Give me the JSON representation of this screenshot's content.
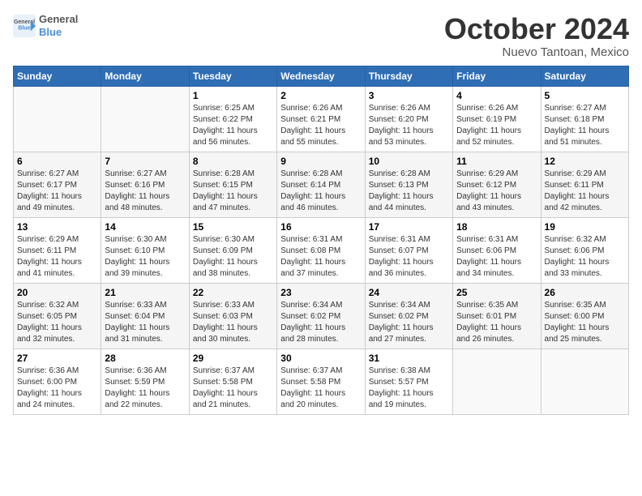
{
  "logo": {
    "line1": "General",
    "line2": "Blue"
  },
  "title": "October 2024",
  "location": "Nuevo Tantoan, Mexico",
  "days_header": [
    "Sunday",
    "Monday",
    "Tuesday",
    "Wednesday",
    "Thursday",
    "Friday",
    "Saturday"
  ],
  "weeks": [
    [
      {
        "day": "",
        "info": ""
      },
      {
        "day": "",
        "info": ""
      },
      {
        "day": "1",
        "info": "Sunrise: 6:25 AM\nSunset: 6:22 PM\nDaylight: 11 hours\nand 56 minutes."
      },
      {
        "day": "2",
        "info": "Sunrise: 6:26 AM\nSunset: 6:21 PM\nDaylight: 11 hours\nand 55 minutes."
      },
      {
        "day": "3",
        "info": "Sunrise: 6:26 AM\nSunset: 6:20 PM\nDaylight: 11 hours\nand 53 minutes."
      },
      {
        "day": "4",
        "info": "Sunrise: 6:26 AM\nSunset: 6:19 PM\nDaylight: 11 hours\nand 52 minutes."
      },
      {
        "day": "5",
        "info": "Sunrise: 6:27 AM\nSunset: 6:18 PM\nDaylight: 11 hours\nand 51 minutes."
      }
    ],
    [
      {
        "day": "6",
        "info": "Sunrise: 6:27 AM\nSunset: 6:17 PM\nDaylight: 11 hours\nand 49 minutes."
      },
      {
        "day": "7",
        "info": "Sunrise: 6:27 AM\nSunset: 6:16 PM\nDaylight: 11 hours\nand 48 minutes."
      },
      {
        "day": "8",
        "info": "Sunrise: 6:28 AM\nSunset: 6:15 PM\nDaylight: 11 hours\nand 47 minutes."
      },
      {
        "day": "9",
        "info": "Sunrise: 6:28 AM\nSunset: 6:14 PM\nDaylight: 11 hours\nand 46 minutes."
      },
      {
        "day": "10",
        "info": "Sunrise: 6:28 AM\nSunset: 6:13 PM\nDaylight: 11 hours\nand 44 minutes."
      },
      {
        "day": "11",
        "info": "Sunrise: 6:29 AM\nSunset: 6:12 PM\nDaylight: 11 hours\nand 43 minutes."
      },
      {
        "day": "12",
        "info": "Sunrise: 6:29 AM\nSunset: 6:11 PM\nDaylight: 11 hours\nand 42 minutes."
      }
    ],
    [
      {
        "day": "13",
        "info": "Sunrise: 6:29 AM\nSunset: 6:11 PM\nDaylight: 11 hours\nand 41 minutes."
      },
      {
        "day": "14",
        "info": "Sunrise: 6:30 AM\nSunset: 6:10 PM\nDaylight: 11 hours\nand 39 minutes."
      },
      {
        "day": "15",
        "info": "Sunrise: 6:30 AM\nSunset: 6:09 PM\nDaylight: 11 hours\nand 38 minutes."
      },
      {
        "day": "16",
        "info": "Sunrise: 6:31 AM\nSunset: 6:08 PM\nDaylight: 11 hours\nand 37 minutes."
      },
      {
        "day": "17",
        "info": "Sunrise: 6:31 AM\nSunset: 6:07 PM\nDaylight: 11 hours\nand 36 minutes."
      },
      {
        "day": "18",
        "info": "Sunrise: 6:31 AM\nSunset: 6:06 PM\nDaylight: 11 hours\nand 34 minutes."
      },
      {
        "day": "19",
        "info": "Sunrise: 6:32 AM\nSunset: 6:06 PM\nDaylight: 11 hours\nand 33 minutes."
      }
    ],
    [
      {
        "day": "20",
        "info": "Sunrise: 6:32 AM\nSunset: 6:05 PM\nDaylight: 11 hours\nand 32 minutes."
      },
      {
        "day": "21",
        "info": "Sunrise: 6:33 AM\nSunset: 6:04 PM\nDaylight: 11 hours\nand 31 minutes."
      },
      {
        "day": "22",
        "info": "Sunrise: 6:33 AM\nSunset: 6:03 PM\nDaylight: 11 hours\nand 30 minutes."
      },
      {
        "day": "23",
        "info": "Sunrise: 6:34 AM\nSunset: 6:02 PM\nDaylight: 11 hours\nand 28 minutes."
      },
      {
        "day": "24",
        "info": "Sunrise: 6:34 AM\nSunset: 6:02 PM\nDaylight: 11 hours\nand 27 minutes."
      },
      {
        "day": "25",
        "info": "Sunrise: 6:35 AM\nSunset: 6:01 PM\nDaylight: 11 hours\nand 26 minutes."
      },
      {
        "day": "26",
        "info": "Sunrise: 6:35 AM\nSunset: 6:00 PM\nDaylight: 11 hours\nand 25 minutes."
      }
    ],
    [
      {
        "day": "27",
        "info": "Sunrise: 6:36 AM\nSunset: 6:00 PM\nDaylight: 11 hours\nand 24 minutes."
      },
      {
        "day": "28",
        "info": "Sunrise: 6:36 AM\nSunset: 5:59 PM\nDaylight: 11 hours\nand 22 minutes."
      },
      {
        "day": "29",
        "info": "Sunrise: 6:37 AM\nSunset: 5:58 PM\nDaylight: 11 hours\nand 21 minutes."
      },
      {
        "day": "30",
        "info": "Sunrise: 6:37 AM\nSunset: 5:58 PM\nDaylight: 11 hours\nand 20 minutes."
      },
      {
        "day": "31",
        "info": "Sunrise: 6:38 AM\nSunset: 5:57 PM\nDaylight: 11 hours\nand 19 minutes."
      },
      {
        "day": "",
        "info": ""
      },
      {
        "day": "",
        "info": ""
      }
    ]
  ]
}
